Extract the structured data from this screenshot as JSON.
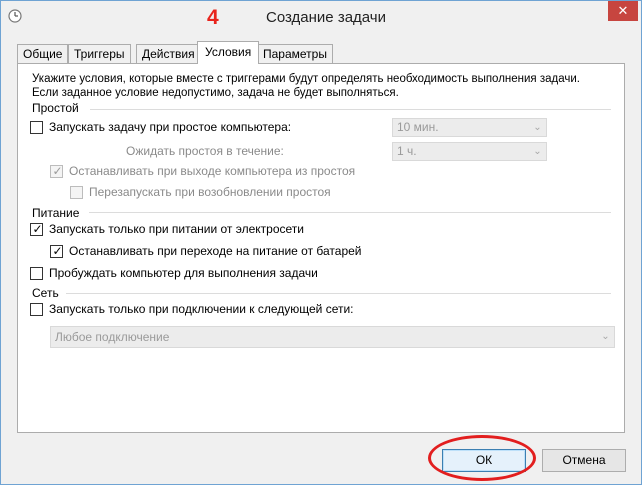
{
  "window": {
    "title": "Создание задачи",
    "annotation_number": "4",
    "close_symbol": "✕"
  },
  "tabs": [
    {
      "label": "Общие",
      "active": false
    },
    {
      "label": "Триггеры",
      "active": false
    },
    {
      "label": "Действия",
      "active": false
    },
    {
      "label": "Условия",
      "active": true
    },
    {
      "label": "Параметры",
      "active": false
    }
  ],
  "description": {
    "line1": "Укажите условия, которые вместе с триггерами будут определять необходимость выполнения задачи.",
    "line2": "Если заданное условие недопустимо, задача не будет выполняться."
  },
  "idle": {
    "group_label": "Простой",
    "start_if_idle": {
      "label": "Запускать задачу при простое компьютера:",
      "checked": false
    },
    "idle_duration": {
      "value": "10 мин."
    },
    "wait_label": "Ожидать простоя в течение:",
    "wait_duration": {
      "value": "1 ч."
    },
    "stop_on_idle_end": {
      "label": "Останавливать при выходе компьютера из простоя",
      "checked": true
    },
    "restart_on_idle": {
      "label": "Перезапускать при возобновлении простоя",
      "checked": false
    }
  },
  "power": {
    "group_label": "Питание",
    "ac_only": {
      "label": "Запускать только при питании от электросети",
      "checked": true
    },
    "stop_on_battery": {
      "label": "Останавливать при переходе на питание от батарей",
      "checked": true
    },
    "wake": {
      "label": "Пробуждать компьютер для выполнения задачи",
      "checked": false
    }
  },
  "network": {
    "group_label": "Сеть",
    "network_only": {
      "label": "Запускать только при подключении к следующей сети:",
      "checked": false
    },
    "connection": {
      "value": "Любое подключение"
    }
  },
  "buttons": {
    "ok": "ОК",
    "cancel": "Отмена"
  },
  "glyphs": {
    "check": "✓",
    "dropdown": "⌄"
  },
  "colors": {
    "annotation_red": "#e21e1e",
    "close_button": "#c7453f"
  }
}
